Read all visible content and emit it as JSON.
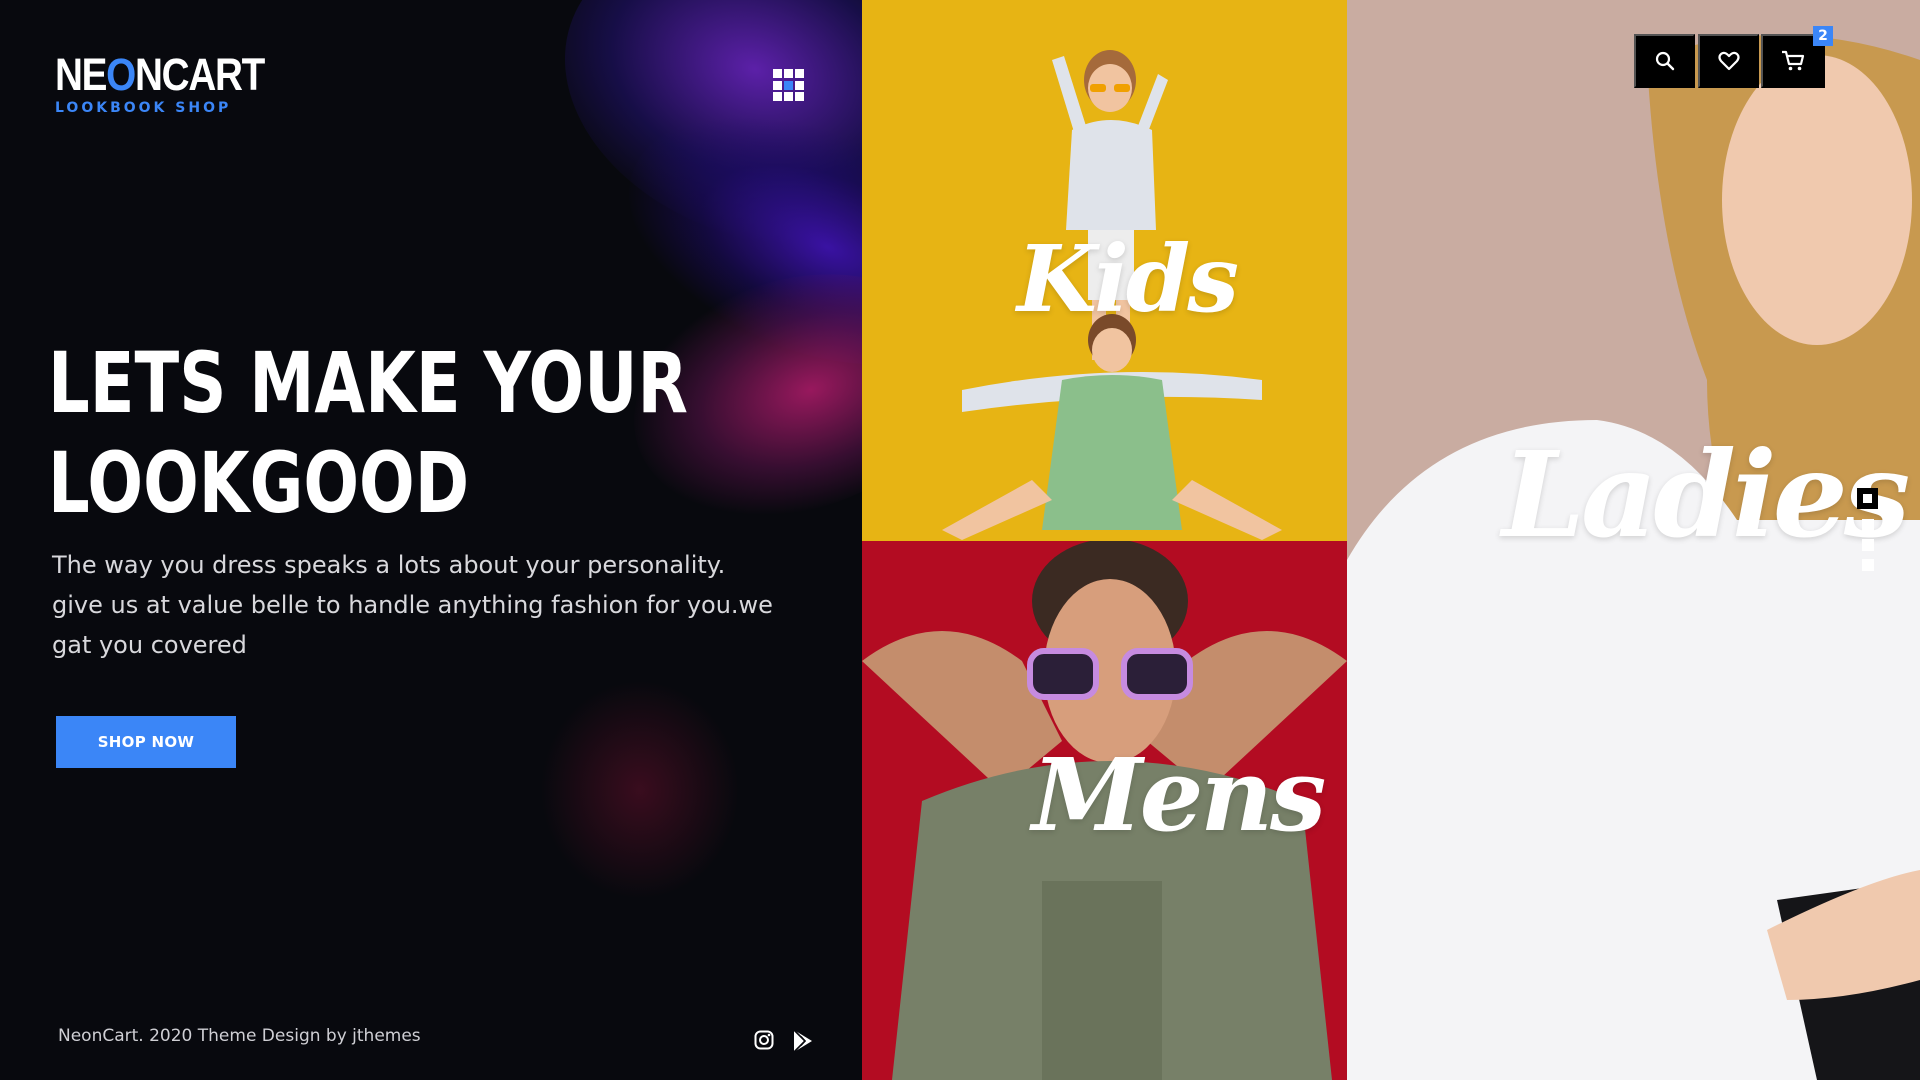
{
  "brand": {
    "name_before": "NE",
    "name_o": "O",
    "name_after": "NCART",
    "tagline": "LOOKBOOK SHOP",
    "accent": "#3b86f7"
  },
  "menu": {
    "icon": "grid-menu-icon"
  },
  "hero": {
    "headline_line1": "LETS MAKE YOUR",
    "headline_line2": "LOOKGOOD",
    "description": "The way you dress speaks a lots about your personality. give us at value belle to handle anything fashion for you.we gat you covered",
    "cta_label": "SHOP NOW"
  },
  "footer": {
    "credit": "NeonCart. 2020 Theme Design by jthemes",
    "social": [
      "instagram-icon",
      "google-play-icon"
    ]
  },
  "categories": {
    "kids": {
      "label": "Kids",
      "bg": "#e7b414"
    },
    "mens": {
      "label": "Mens",
      "bg": "#b30c22"
    },
    "ladies": {
      "label": "Ladies",
      "bg": "#c9aca1"
    }
  },
  "header_actions": {
    "search_icon": "search-icon",
    "wishlist_icon": "heart-icon",
    "cart_icon": "cart-icon",
    "cart_count": "2"
  },
  "slider_dots": {
    "count": 4,
    "active_index": 0
  }
}
